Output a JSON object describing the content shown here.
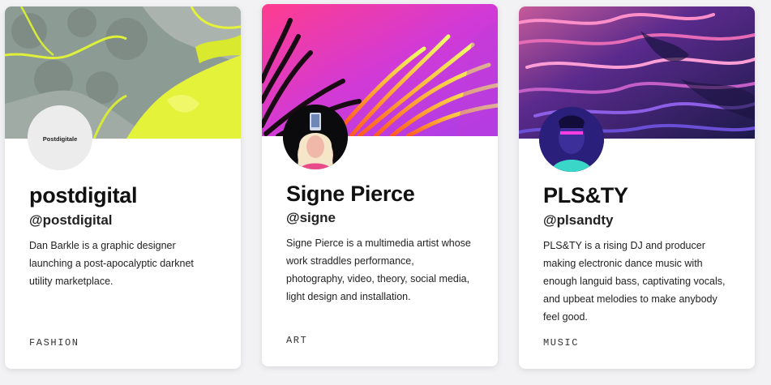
{
  "cards": [
    {
      "avatar_text": "Postdigitale",
      "name": "postdigital",
      "handle": "@postdigital",
      "bio": "Dan Barkle is a graphic designer launching a post-apocalyptic darknet utility marketplace.",
      "tag": "FASHION"
    },
    {
      "name": "Signe Pierce",
      "handle": "@signe",
      "bio": "Signe Pierce is a multimedia artist whose work straddles performance, photography, video, theory, social media, light design and installation.",
      "tag": "ART"
    },
    {
      "name": "PLS&TY",
      "handle": "@plsandty",
      "bio": "PLS&TY is a rising DJ and producer making electronic dance music with enough languid bass, captivating vocals, and upbeat melodies to make anybody feel good.",
      "tag": "MUSIC"
    }
  ],
  "colors": {
    "background": "#f2f2f4",
    "card": "#ffffff",
    "text": "#111111",
    "cover_1_accent": "#e4f23a",
    "cover_2_accent": "#d23ad6",
    "cover_3_accent": "#3a2a8c"
  }
}
